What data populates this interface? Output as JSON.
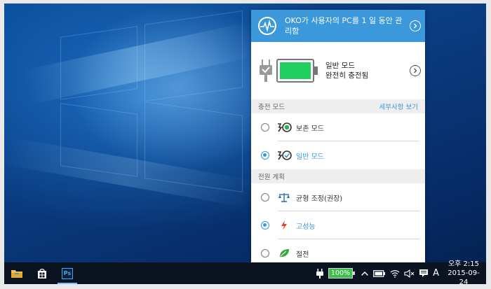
{
  "flyout": {
    "header_text": "OKO가 사용자의 PC를 1 일 동안 관리함",
    "battery": {
      "mode": "일반 모드",
      "status": "완전히 충전됨",
      "level": 1.0,
      "color": "#1fcf5f"
    },
    "charging_section": {
      "title": "충전 모드",
      "details_link": "세부사항 보기",
      "options": [
        {
          "label": "보존 모드",
          "selected": false,
          "icon": "battery-heart-icon"
        },
        {
          "label": "일반 모드",
          "selected": true,
          "icon": "battery-check-icon"
        }
      ]
    },
    "power_section": {
      "title": "전원 계획",
      "options": [
        {
          "label": "균형 조정(권장)",
          "selected": false,
          "icon": "balance-scale-icon"
        },
        {
          "label": "고성능",
          "selected": true,
          "icon": "lightning-icon"
        },
        {
          "label": "절전",
          "selected": false,
          "icon": "leaf-icon"
        }
      ]
    }
  },
  "taskbar": {
    "apps": [
      {
        "name": "file-explorer-icon"
      },
      {
        "name": "store-icon"
      },
      {
        "name": "photoshop-icon",
        "label": "Ps",
        "active": true
      }
    ],
    "tray": {
      "battery_percent": "100%",
      "ime_label": "A",
      "time": "오후 2:15",
      "date": "2015-09-24"
    }
  },
  "colors": {
    "accent": "#3a98db",
    "battery_green": "#1fcf5f",
    "taskbar": "#0b1220"
  }
}
